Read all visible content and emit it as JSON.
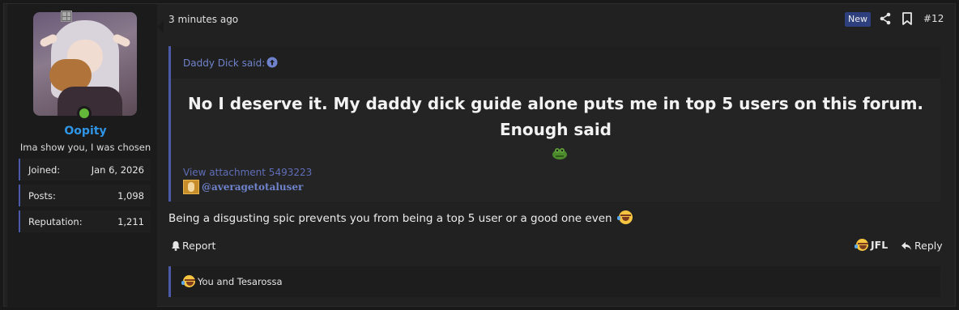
{
  "user": {
    "username": "Oopity",
    "title": "Ima show you, I was chosen",
    "stats": [
      {
        "label": "Joined:",
        "value": "Jan 6, 2026"
      },
      {
        "label": "Posts:",
        "value": "1,098"
      },
      {
        "label": "Reputation:",
        "value": "1,211"
      }
    ],
    "online": true
  },
  "post": {
    "time": "3 minutes ago",
    "badge": "New",
    "number": "#12",
    "quote": {
      "author": "Daddy Dick said:",
      "text_line1": "No I deserve it. My daddy dick guide alone puts me in top 5 users on this forum.",
      "text_line2": "Enough said",
      "attachment": "View attachment 5493223",
      "mention": "@averagetotaluser"
    },
    "body": "Being a disgusting spic prevents you from being a top 5 user or a good one even",
    "actions": {
      "report": "Report",
      "react": "JFL",
      "reply": "Reply"
    },
    "reactions_summary": "You and Tesarossa"
  },
  "colors": {
    "accent": "#4b5aa8",
    "username": "#2f95e6",
    "link": "#6f83cc",
    "online": "#63b83a",
    "badge": "#2e3f7e"
  },
  "icons": [
    "share-icon",
    "bookmark-icon",
    "arrow-up-circle-icon",
    "bell-icon",
    "reply-icon",
    "laughing-emoji-icon",
    "frog-emoji-icon"
  ]
}
